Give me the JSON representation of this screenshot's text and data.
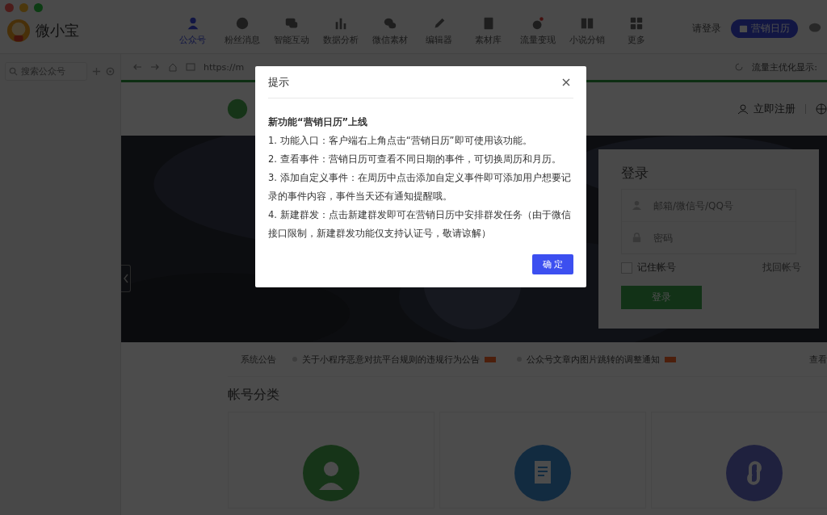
{
  "app": {
    "name": "微小宝"
  },
  "nav": [
    {
      "label": "公众号",
      "selected": true
    },
    {
      "label": "粉丝消息",
      "selected": false
    },
    {
      "label": "智能互动",
      "selected": false
    },
    {
      "label": "数据分析",
      "selected": false
    },
    {
      "label": "微信素材",
      "selected": false
    },
    {
      "label": "编辑器",
      "selected": false
    },
    {
      "label": "素材库",
      "selected": false
    },
    {
      "label": "流量变现",
      "selected": false
    },
    {
      "label": "小说分销",
      "selected": false
    },
    {
      "label": "更多",
      "selected": false
    }
  ],
  "header_right": {
    "login_link": "请登录",
    "calendar_button": "营销日历"
  },
  "sidebar": {
    "search_placeholder": "搜索公众号"
  },
  "browser": {
    "url": "https://m",
    "traffic_label": "流量主优化显示:"
  },
  "site": {
    "register_link": "立即注册",
    "login": {
      "title": "登录",
      "username_placeholder": "邮箱/微信号/QQ号",
      "password_placeholder": "密码",
      "remember": {
        "label": "记住帐号",
        "checked": false
      },
      "forgot_link": "找回帐号",
      "submit": "登录"
    },
    "notices": {
      "label": "系统公告",
      "items": [
        {
          "text": "关于小程序恶意对抗平台规则的违规行为公告",
          "new": true
        },
        {
          "text": "公众号文章内图片跳转的调整通知",
          "new": true
        }
      ],
      "more": "查看"
    },
    "section_title": "帐号分类",
    "categories": [
      {
        "kind": "person"
      },
      {
        "kind": "article"
      },
      {
        "kind": "miniprogram"
      }
    ]
  },
  "dialog": {
    "title": "提示",
    "heading": "新功能“营销日历”上线",
    "lines": [
      "1. 功能入口：客户端右上角点击“营销日历”即可使用该功能。",
      "2. 查看事件：营销日历可查看不同日期的事件，可切换周历和月历。",
      "3. 添加自定义事件：在周历中点击添加自定义事件即可添加用户想要记录的事件内容，事件当天还有通知提醒哦。",
      "4. 新建群发：点击新建群发即可在营销日历中安排群发任务（由于微信接口限制，新建群发功能仅支持认证号，敬请谅解）"
    ],
    "confirm": "确 定"
  }
}
